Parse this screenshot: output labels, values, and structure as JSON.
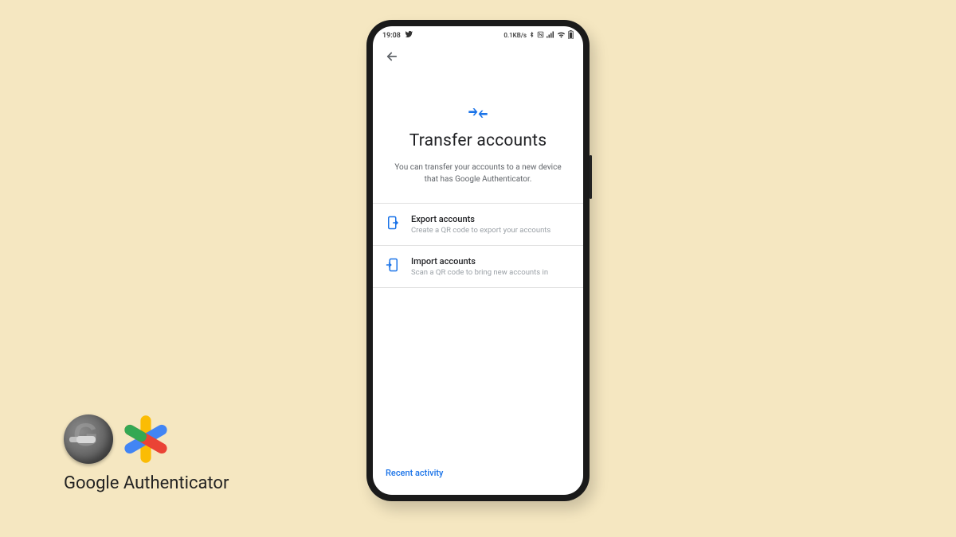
{
  "statusBar": {
    "time": "19:08",
    "networkSpeed": "0.1KB/s"
  },
  "page": {
    "title": "Transfer accounts",
    "description": "You can transfer your accounts to a new device that has Google Authenticator."
  },
  "options": {
    "export": {
      "title": "Export accounts",
      "subtitle": "Create a QR code to export your accounts"
    },
    "import": {
      "title": "Import accounts",
      "subtitle": "Scan a QR code to bring new accounts in"
    }
  },
  "footer": {
    "recentActivity": "Recent activity"
  },
  "brand": {
    "label": "Google Authenticator"
  }
}
